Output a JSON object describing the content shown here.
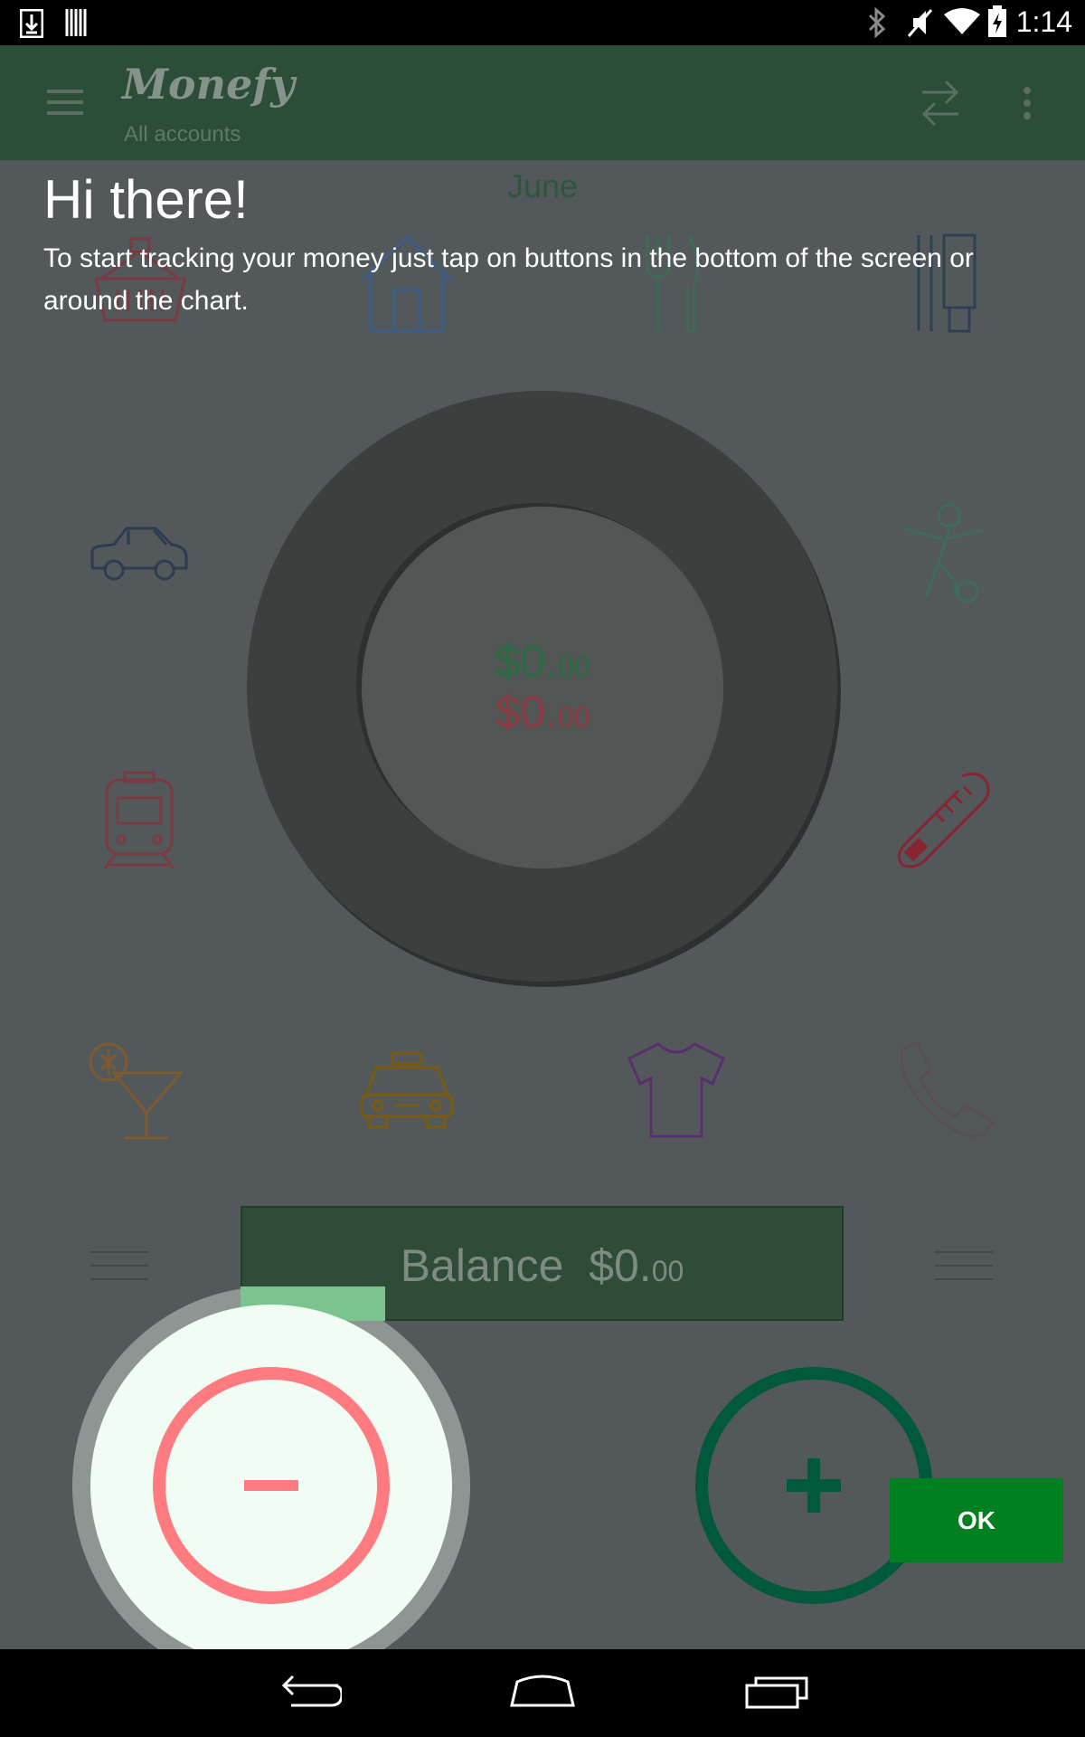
{
  "status_bar": {
    "time": "1:14",
    "icons": [
      "download-icon",
      "barcode-icon",
      "bluetooth-icon",
      "mute-icon",
      "wifi-icon",
      "battery-charging-icon"
    ]
  },
  "app_bar": {
    "title": "Monefy",
    "subtitle": "All accounts",
    "icons": [
      "menu-icon",
      "transfer-icon",
      "more-vert-icon"
    ]
  },
  "coachmark": {
    "title": "Hi there!",
    "body": "To start tracking your money just tap on buttons in the bottom of the screen or around the chart.",
    "ok_label": "OK"
  },
  "main": {
    "month": "June",
    "expense_total": {
      "main": "$0.",
      "cents": "00"
    },
    "income_total": {
      "main": "$0.",
      "cents": "00"
    },
    "balance": {
      "label": "Balance",
      "main": "$0.",
      "cents": "00"
    }
  },
  "categories": [
    {
      "name": "groceries",
      "icon": "basket-icon",
      "color": "#8A3B43"
    },
    {
      "name": "house",
      "icon": "house-icon",
      "color": "#3D5E8A"
    },
    {
      "name": "eating-out",
      "icon": "cutlery-icon",
      "color": "#3E6B55"
    },
    {
      "name": "toiletry",
      "icon": "toothpaste-icon",
      "color": "#2E3F55"
    },
    {
      "name": "car",
      "icon": "car-icon",
      "color": "#2E3C52"
    },
    {
      "name": "sports",
      "icon": "sports-icon",
      "color": "#3E6B5E"
    },
    {
      "name": "transport",
      "icon": "train-icon",
      "color": "#7A3A42"
    },
    {
      "name": "health",
      "icon": "thermometer-icon",
      "color": "#8A2332"
    },
    {
      "name": "entertainment",
      "icon": "cocktail-icon",
      "color": "#7E5A30"
    },
    {
      "name": "taxi",
      "icon": "taxi-icon",
      "color": "#7A5A10"
    },
    {
      "name": "clothes",
      "icon": "tshirt-icon",
      "color": "#5A2F6E"
    },
    {
      "name": "communications",
      "icon": "phone-icon",
      "color": "#5A4E58"
    }
  ],
  "buttons": {
    "expense": {
      "icon": "minus-icon",
      "color": "#FF7B80"
    },
    "income": {
      "icon": "plus-icon",
      "color": "#00593A"
    }
  },
  "nav_bar": {
    "icons": [
      "back-icon",
      "home-icon",
      "recents-icon"
    ]
  }
}
